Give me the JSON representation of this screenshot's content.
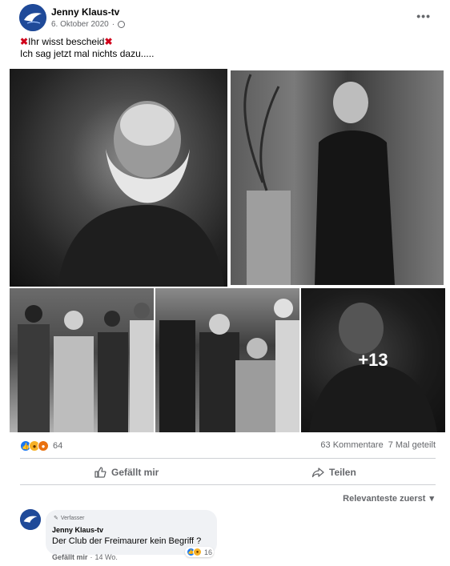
{
  "post": {
    "author": "Jenny Klaus-tv",
    "date": "6. Oktober 2020",
    "dot": "·",
    "more_icon": "ellipsis-icon",
    "line1": "Ihr wisst bescheid",
    "line2": "Ich sag jetzt mal nichts dazu.....",
    "more_photos": "+13"
  },
  "stats": {
    "reaction_count": "64",
    "comments": "63 Kommentare",
    "shares": "7 Mal geteilt"
  },
  "actions": {
    "like": "Gefällt mir",
    "share": "Teilen"
  },
  "comments_section": {
    "sort_label": "Relevanteste zuerst"
  },
  "comment": {
    "badge": "Verfasser",
    "author": "Jenny Klaus-tv",
    "text": "Der Club der Freimaurer kein Begriff ?",
    "reaction_count": "16",
    "like": "Gefällt mir",
    "dot": "·",
    "age": "14 Wo."
  },
  "colors": {
    "accent": "#1877f2",
    "text_secondary": "#65676b",
    "bubble": "#f0f2f5"
  }
}
